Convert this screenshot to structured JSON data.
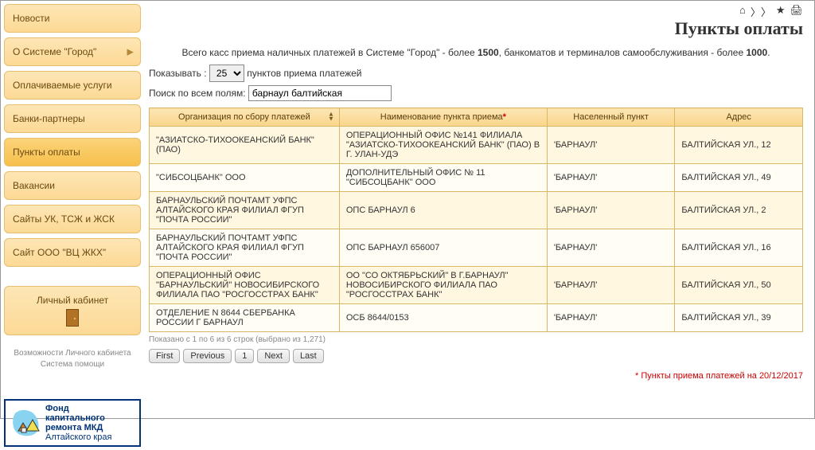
{
  "page": {
    "title": "Пункты оплаты",
    "intro_parts": {
      "p1": "Всего касс приема наличных платежей в Системе \"Город\" - более ",
      "n1": "1500",
      "p2": ", банкоматов и терминалов самообслуживания - более ",
      "n2": "1000",
      "p3": "."
    },
    "show_label_left": "Показывать :",
    "show_options": [
      "25"
    ],
    "show_label_right": " пунктов приема платежей",
    "search_label": "Поиск по всем полям: ",
    "search_value": "барнаул балтийская",
    "table_info": "Показано с 1 по 6 из 6 строк (выбрано из 1,271)",
    "footnote": "* Пункты приема платежей на 20/12/2017"
  },
  "sidebar": {
    "items": [
      {
        "label": "Новости",
        "has_submenu": false,
        "active": false
      },
      {
        "label": "О Системе \"Город\"",
        "has_submenu": true,
        "active": false
      },
      {
        "label": "Оплачиваемые услуги",
        "has_submenu": false,
        "active": false
      },
      {
        "label": "Банки-партнеры",
        "has_submenu": false,
        "active": false
      },
      {
        "label": "Пункты оплаты",
        "has_submenu": false,
        "active": true
      },
      {
        "label": "Вакансии",
        "has_submenu": false,
        "active": false
      },
      {
        "label": "Сайты УК, ТСЖ и ЖСК",
        "has_submenu": false,
        "active": false
      },
      {
        "label": "Сайт ООО \"ВЦ ЖКХ\"",
        "has_submenu": false,
        "active": false
      }
    ],
    "cabinet_label": "Личный кабинет",
    "hint_line1": "Возможности Личного кабинета",
    "hint_line2": "Система помощи",
    "badge_lines": [
      "Фонд",
      "капитального",
      "ремонта МКД",
      "Алтайского края"
    ]
  },
  "table": {
    "headers": [
      "Организация по сбору платежей",
      "Наименование пункта приема",
      "Населенный пункт",
      "Адрес"
    ],
    "rows": [
      {
        "org": "\"АЗИАТСКО-ТИХООКЕАНСКИЙ БАНК\" (ПАО)",
        "name": "ОПЕРАЦИОННЫЙ ОФИС №141 ФИЛИАЛА \"АЗИАТСКО-ТИХООКЕАНСКИЙ БАНК\" (ПАО) В Г. УЛАН-УДЭ",
        "city": "'БАРНАУЛ'",
        "addr": "БАЛТИЙСКАЯ УЛ., 12"
      },
      {
        "org": "\"СИБСОЦБАНК\" ООО",
        "name": "ДОПОЛНИТЕЛЬНЫЙ ОФИС № 11 \"СИБСОЦБАНК\" ООО",
        "city": "'БАРНАУЛ'",
        "addr": "БАЛТИЙСКАЯ УЛ., 49"
      },
      {
        "org": "БАРНАУЛЬСКИЙ ПОЧТАМТ УФПС АЛТАЙСКОГО КРАЯ ФИЛИАЛ ФГУП \"ПОЧТА РОССИИ\"",
        "name": "ОПС БАРНАУЛ 6",
        "city": "'БАРНАУЛ'",
        "addr": "БАЛТИЙСКАЯ УЛ., 2"
      },
      {
        "org": "БАРНАУЛЬСКИЙ ПОЧТАМТ УФПС АЛТАЙСКОГО КРАЯ ФИЛИАЛ ФГУП \"ПОЧТА РОССИИ\"",
        "name": "ОПС БАРНАУЛ 656007",
        "city": "'БАРНАУЛ'",
        "addr": "БАЛТИЙСКАЯ УЛ., 16"
      },
      {
        "org": "ОПЕРАЦИОННЫЙ ОФИС \"БАРНАУЛЬСКИЙ\" НОВОСИБИРСКОГО ФИЛИАЛА ПАО \"РОСГОССТРАХ БАНК\"",
        "name": "ОО \"СО ОКТЯБРЬСКИЙ\" В Г.БАРНАУЛ\" НОВОСИБИРСКОГО ФИЛИАЛА ПАО \"РОСГОССТРАХ БАНК\"",
        "city": "'БАРНАУЛ'",
        "addr": "БАЛТИЙСКАЯ УЛ., 50"
      },
      {
        "org": "ОТДЕЛЕНИЕ N 8644 СБЕРБАНКА РОССИИ Г БАРНАУЛ",
        "name": "ОСБ 8644/0153",
        "city": "'БАРНАУЛ'",
        "addr": "БАЛТИЙСКАЯ УЛ., 39"
      }
    ]
  },
  "pager": {
    "first": "First",
    "prev": "Previous",
    "page": "1",
    "next": "Next",
    "last": "Last"
  }
}
